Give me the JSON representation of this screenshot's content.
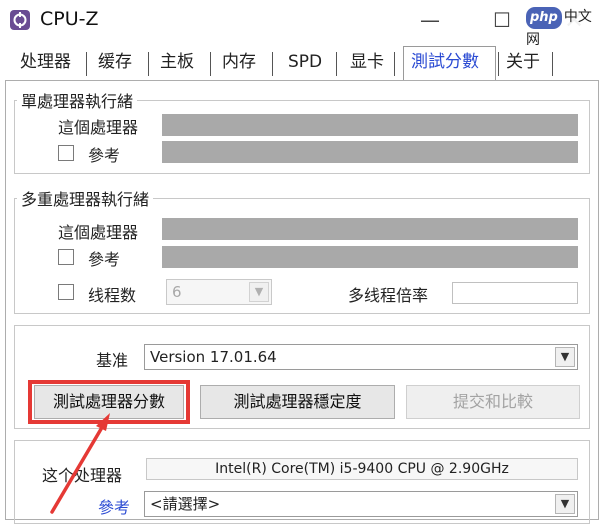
{
  "window": {
    "title": "CPU-Z",
    "minimize_glyph": "—",
    "maximize_glyph": "☐",
    "close_glyph": "✕"
  },
  "watermark": {
    "brand": "php",
    "text": "中文网"
  },
  "tabs": [
    {
      "label": "处理器"
    },
    {
      "label": "缓存"
    },
    {
      "label": "主板"
    },
    {
      "label": "内存"
    },
    {
      "label": "SPD"
    },
    {
      "label": "显卡"
    },
    {
      "label": "測試分數",
      "active": true
    },
    {
      "label": "关于"
    }
  ],
  "single_thread": {
    "legend": "單處理器執行緒",
    "this_processor_label": "這個處理器",
    "reference_label": "參考"
  },
  "multi_thread": {
    "legend": "多重處理器執行緒",
    "this_processor_label": "這個處理器",
    "reference_label": "參考",
    "threads_label": "线程数",
    "threads_value": "6",
    "multi_ratio_label": "多线程倍率"
  },
  "benchmark": {
    "label": "基准",
    "version": "Version 17.01.64",
    "bench_cpu_button": "測試處理器分數",
    "stress_cpu_button": "測試處理器穩定度",
    "submit_button": "提交和比較"
  },
  "compare": {
    "this_processor_label": "这个处理器",
    "cpu_name": "Intel(R) Core(TM) i5-9400 CPU @ 2.90GHz",
    "reference_label": "參考",
    "reference_select": "<請選擇>"
  },
  "colors": {
    "active_tab": "#2b4bd3",
    "highlight": "#e53935",
    "bar": "#a9a9a9"
  },
  "icons": {
    "app": "cpu-z-app-icon",
    "dropdown": "chevron-down-icon"
  }
}
